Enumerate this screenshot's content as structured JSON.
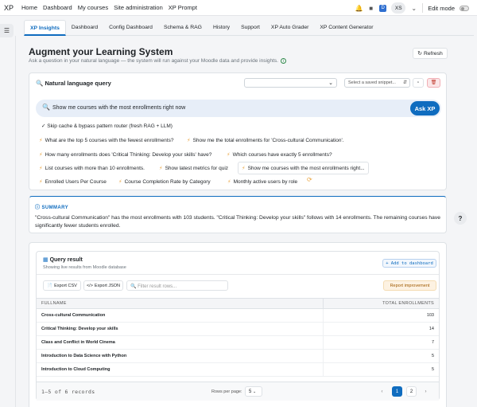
{
  "topbar": {
    "brand": "XP",
    "nav": [
      "Home",
      "Dashboard",
      "My courses",
      "Site administration",
      "XP Prompt"
    ],
    "user_initials": "XS",
    "edit_mode_label": "Edit mode"
  },
  "tabs": [
    "XP Insights",
    "Dashboard",
    "Config Dashboard",
    "Schema & RAG",
    "History",
    "Support",
    "XP Auto Grader",
    "XP Content Generator"
  ],
  "page": {
    "title": "Augment your Learning System",
    "subtitle": "Ask a question in your natural language — the system will run against your Moodle data and provide insights.",
    "refresh_label": "Refresh"
  },
  "query": {
    "title": "Natural language query",
    "snippet_placeholder": "Select a saved snippet...",
    "input_value": "Show me courses with the most enrollments right now",
    "ask_label": "Ask XP",
    "skip_cache_label": "Skip cache & bypass pattern router (fresh RAG + LLM)",
    "suggestions": [
      "What are the top 5 courses with the fewest enrollments?",
      "Show me the total enrollments for 'Cross-cultural Communication'.",
      "How many enrollments does 'Critical Thinking: Develop your skills' have?",
      "Which courses have exactly 5 enrollments?",
      "List courses with more than 10 enrollments.",
      "Show latest metrics for quiz",
      "Show me courses with the most enrollments right...",
      "Enrolled Users Per Course",
      "Course Completion Rate by Category",
      "Monthly active users by role"
    ]
  },
  "summary": {
    "label": "SUMMARY",
    "text": "\"Cross-cultural Communication\" has the most enrollments with 103 students. \"Critical Thinking: Develop your skills\" follows with 14 enrollments. The remaining courses have significantly fewer students enrolled."
  },
  "result": {
    "title": "Query result",
    "subtitle": "Showing live results from Moodle database",
    "add_dashboard_label": "+ Add to dashboard",
    "export_csv_label": "Export CSV",
    "export_json_label": "Export JSON",
    "filter_placeholder": "Filter result rows...",
    "report_label": "Report improvement",
    "columns": [
      "FULLNAME",
      "TOTAL ENROLLMENTS"
    ],
    "rows": [
      [
        "Cross-cultural Communication",
        "103"
      ],
      [
        "Critical Thinking: Develop your skills",
        "14"
      ],
      [
        "Class and Conflict in World Cinema",
        "7"
      ],
      [
        "Introduction to Data Science with Python",
        "5"
      ],
      [
        "Introduction to Cloud Computing",
        "5"
      ]
    ],
    "records_label": "1–5 of 6 records",
    "rows_per_page_label": "Rows per page:",
    "rows_per_page_value": "5",
    "pages": [
      "1",
      "2"
    ]
  }
}
